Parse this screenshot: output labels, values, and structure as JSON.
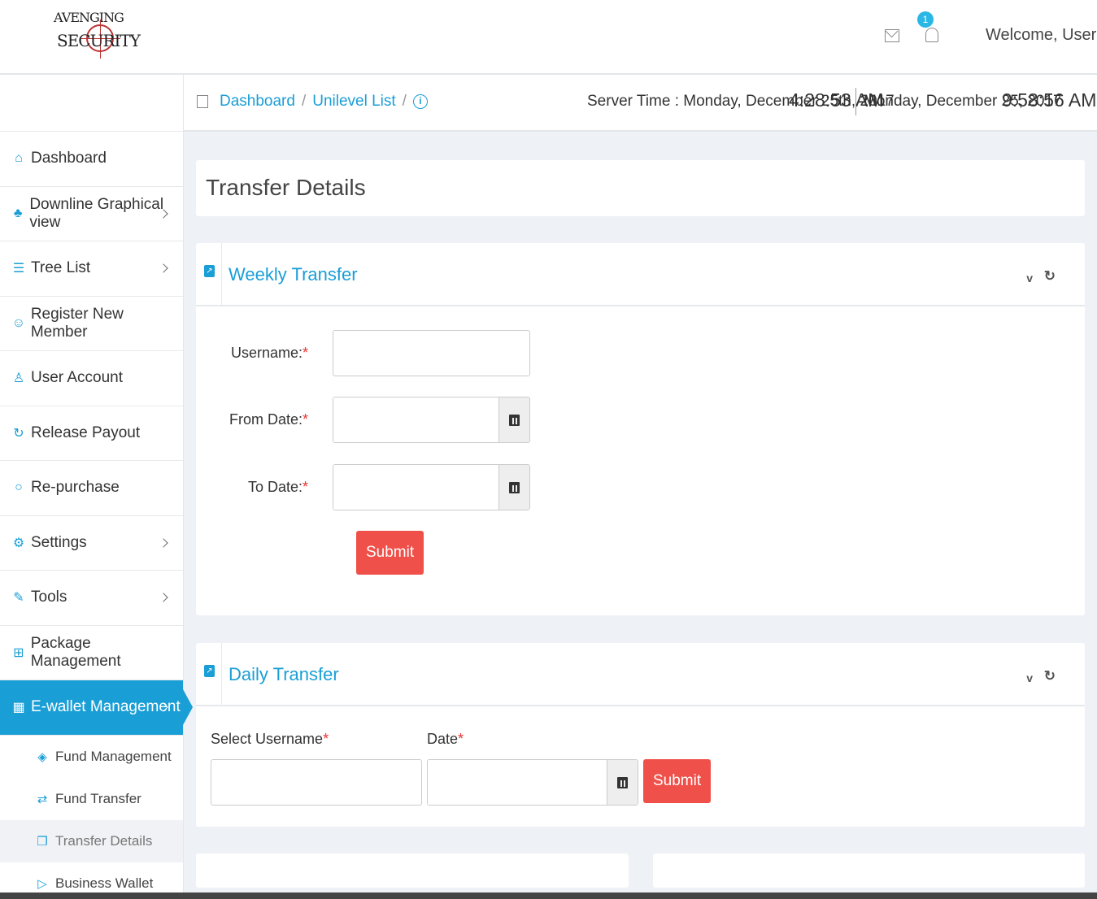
{
  "brand": {
    "line1": "VENGING",
    "line2": "ECURITY",
    "initial1": "A",
    "initial2": "S"
  },
  "header": {
    "notification_count": "1",
    "welcome": "Welcome, User"
  },
  "breadcrumb": {
    "items": [
      "Dashboard",
      "Unilevel List"
    ],
    "separator": "/",
    "info": "i"
  },
  "time": {
    "server_label": "Server Time : Monday, December 25th, 2017",
    "server_clock": "4:28:53 AM",
    "local_date": "Monday, December 25, 2017",
    "local_clock": "9:58:56 AM"
  },
  "sidebar": {
    "items": [
      {
        "label": "Dashboard",
        "icon": "home-icon",
        "glyph": "⌂",
        "chevron": false
      },
      {
        "label": "Downline Graphical view",
        "icon": "sitemap-icon",
        "glyph": "♣",
        "chevron": true
      },
      {
        "label": "Tree List",
        "icon": "list-icon",
        "glyph": "☰",
        "chevron": true
      },
      {
        "label": "Register New Member",
        "icon": "add-user-icon",
        "glyph": "☺",
        "chevron": false
      },
      {
        "label": "User Account",
        "icon": "user-icon",
        "glyph": "♙",
        "chevron": false
      },
      {
        "label": "Release Payout",
        "icon": "reload-icon",
        "glyph": "↻",
        "chevron": false
      },
      {
        "label": "Re-purchase",
        "icon": "circle-icon",
        "glyph": "○",
        "chevron": false
      },
      {
        "label": "Settings",
        "icon": "gear-icon",
        "glyph": "⚙",
        "chevron": true
      },
      {
        "label": "Tools",
        "icon": "wrench-icon",
        "glyph": "✎",
        "chevron": true
      },
      {
        "label": "Package Management",
        "icon": "grid-icon",
        "glyph": "⊞",
        "chevron": false
      },
      {
        "label": "E-wallet Management",
        "icon": "calendar-icon",
        "glyph": "▦",
        "chevron": true,
        "active": true
      }
    ],
    "sub_items": [
      {
        "label": "Fund Management",
        "icon": "diamond-icon",
        "glyph": "◈"
      },
      {
        "label": "Fund Transfer",
        "icon": "transfer-icon",
        "glyph": "⇄"
      },
      {
        "label": "Transfer Details",
        "icon": "copy-icon",
        "glyph": "❐",
        "current": true
      },
      {
        "label": "Business Wallet",
        "icon": "tag-icon",
        "glyph": "▷"
      }
    ]
  },
  "page": {
    "title": "Transfer Details"
  },
  "weekly": {
    "title": "Weekly Transfer",
    "username_label": "Username:",
    "from_label": "From Date:",
    "to_label": "To Date:",
    "required": "*",
    "username_value": "",
    "from_value": "",
    "to_value": "",
    "submit": "Submit"
  },
  "daily": {
    "title": "Daily Transfer",
    "username_label": "Select Username",
    "date_label": "Date",
    "required": "*",
    "username_value": "",
    "date_value": "",
    "submit": "Submit"
  },
  "icons": {
    "collapse": "v",
    "refresh": "↻"
  },
  "colors": {
    "accent": "#1a9ed6",
    "button": "#f0504a",
    "required": "#e33333"
  }
}
